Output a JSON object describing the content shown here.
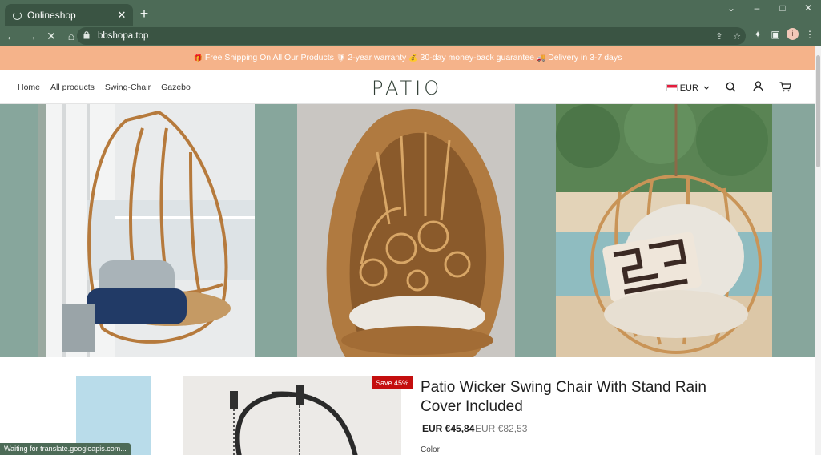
{
  "browser": {
    "tab_title": "Onlineshop",
    "tab_close": "✕",
    "new_tab": "+",
    "url": "bbshopa.top",
    "window_controls": [
      "⌄",
      "–",
      "□",
      "✕"
    ],
    "nav_icons": [
      "←",
      "→",
      "✕",
      "⌂"
    ],
    "status_text": "Waiting for translate.googleapis.com..."
  },
  "announcement": {
    "items": [
      {
        "icon": "gift-icon",
        "glyph": "🎁",
        "text": "Free Shipping On All Our Products"
      },
      {
        "icon": "shield-icon",
        "glyph": "🛡",
        "text": "2-year warranty"
      },
      {
        "icon": "money-icon",
        "glyph": "💰",
        "text": "30-day money-back guarantee"
      },
      {
        "icon": "truck-icon",
        "glyph": "🚚",
        "text": "Delivery in 3-7 days"
      }
    ]
  },
  "header": {
    "nav": [
      "Home",
      "All products",
      "Swing-Chair",
      "Gazebo"
    ],
    "logo": "PATIO",
    "currency": "EUR"
  },
  "product": {
    "badge": "Save 45%",
    "title": "Patio Wicker Swing Chair With Stand Rain Cover Included",
    "price": "EUR €45,84",
    "old_price": "EUR €82,53",
    "color_label": "Color"
  },
  "colors": {
    "browser_chrome": "#4d6b57",
    "announcement_bg": "#f5b38a",
    "hero_bg": "#87a69c",
    "sale_badge": "#c40e0e"
  }
}
